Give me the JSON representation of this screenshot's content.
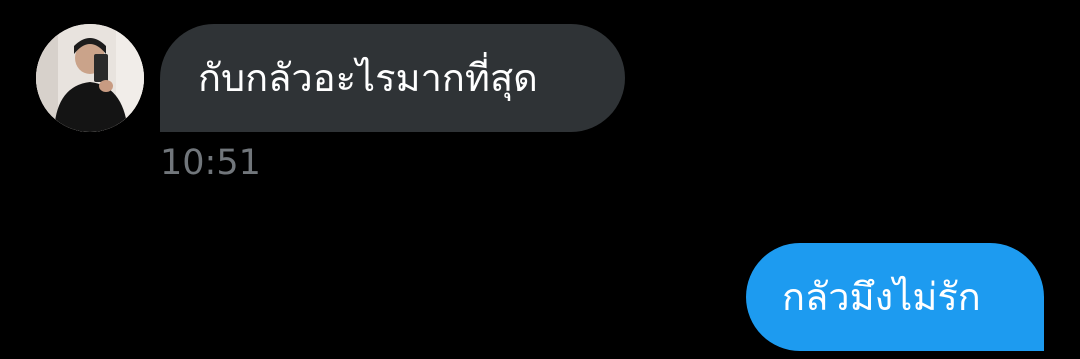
{
  "conversation": {
    "messages": [
      {
        "direction": "incoming",
        "text": "กับกลัวอะไรมากที่สุด",
        "time": "10:51",
        "bubble_color": "#2f3336"
      },
      {
        "direction": "outgoing",
        "text": "กลัวมึงไม่รัก",
        "bubble_color": "#1d9bf0"
      }
    ],
    "sender_avatar_icon": "user-photo-avatar",
    "colors": {
      "background": "#000000",
      "timestamp": "#71767b",
      "text": "#ffffff"
    }
  }
}
